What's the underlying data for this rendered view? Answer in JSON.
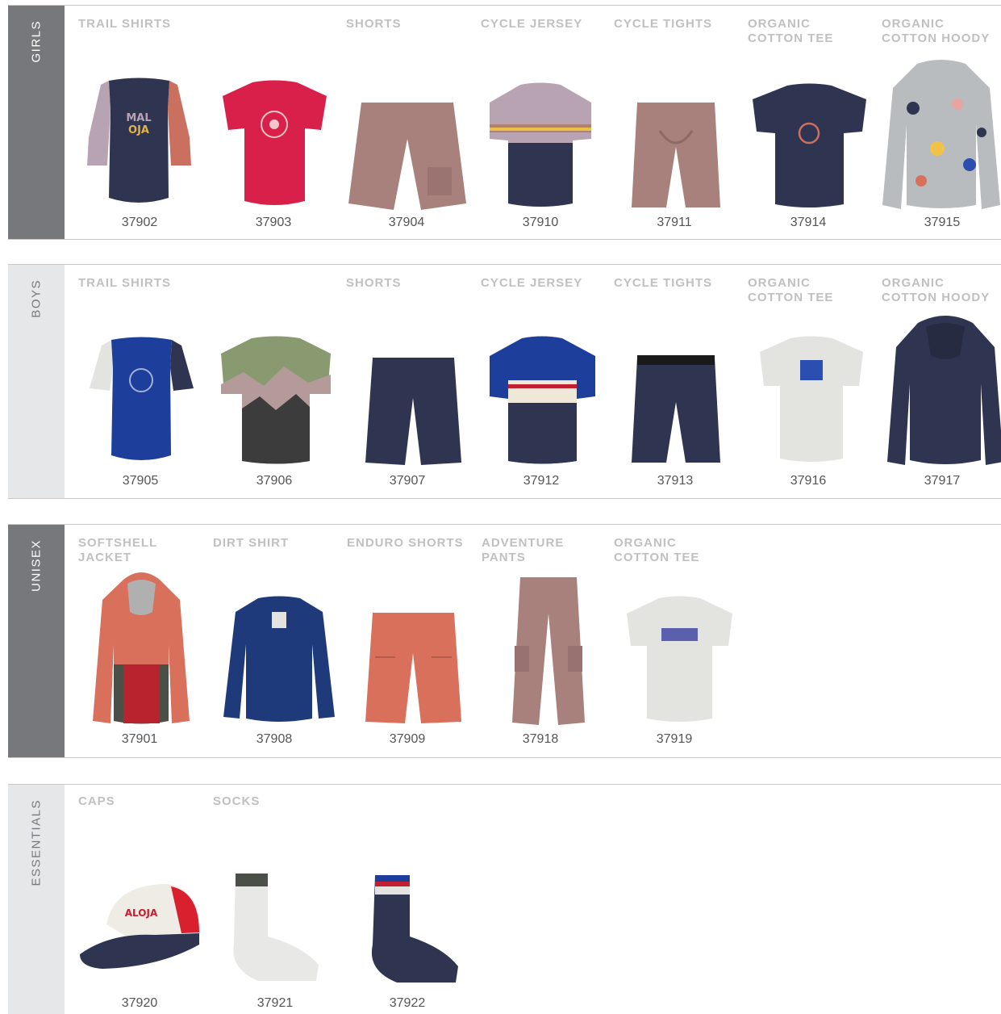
{
  "sections": [
    {
      "label": "GIRLS",
      "categories": [
        "TRAIL SHIRTS",
        "SHORTS",
        "CYCLE JERSEY",
        "CYCLE TIGHTS",
        "ORGANIC",
        "COTTON TEE",
        "ORGANIC",
        "COTTON HOODY"
      ],
      "codes": [
        "37902",
        "37903",
        "37904",
        "37910",
        "37911",
        "37914",
        "37915"
      ]
    },
    {
      "label": "BOYS",
      "categories": [
        "TRAIL SHIRTS",
        "SHORTS",
        "CYCLE JERSEY",
        "CYCLE TIGHTS",
        "ORGANIC",
        "COTTON TEE",
        "ORGANIC",
        "COTTON HOODY"
      ],
      "codes": [
        "37905",
        "37906",
        "37907",
        "37912",
        "37913",
        "37916",
        "37917"
      ]
    },
    {
      "label": "UNISEX",
      "categories": [
        "SOFTSHELL",
        "JACKET",
        "DIRT SHIRT",
        "ENDURO SHORTS",
        "ADVENTURE",
        "PANTS",
        "ORGANIC",
        "COTTON TEE"
      ],
      "codes": [
        "37901",
        "37908",
        "37909",
        "37918",
        "37919"
      ]
    },
    {
      "label": "ESSENTIALS",
      "categories": [
        "CAPS",
        "SOCKS"
      ],
      "codes": [
        "37920",
        "37921",
        "37922"
      ]
    }
  ],
  "colors": {
    "navy": "#2f3550",
    "mauve": "#b8a3b3",
    "rose": "#a8807c",
    "red": "#d8204a",
    "salmon": "#d9705c",
    "royal": "#1d3e9a",
    "sage": "#8a9a70",
    "lightgrey": "#e3e3e0"
  }
}
